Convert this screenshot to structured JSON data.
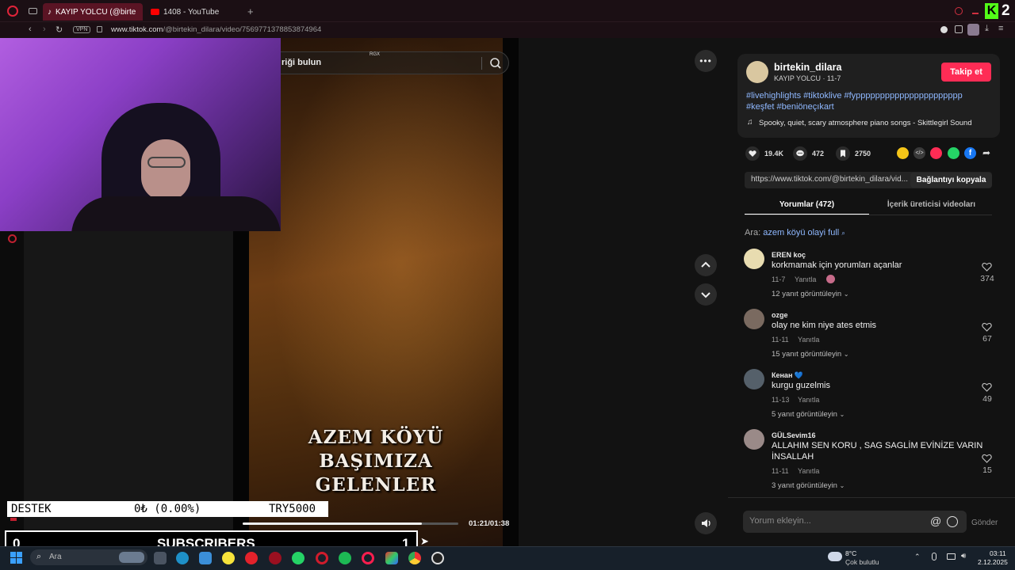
{
  "browser": {
    "tabs": [
      {
        "label": "KAYIP YOLCU (@birte"
      },
      {
        "label": "1408 - YouTube"
      }
    ],
    "vpn_label": "VPN",
    "url_host": "www.tiktok.com",
    "url_path": "/@birtekin_dilara/video/7569771378853874964",
    "k_badge": "2"
  },
  "search": {
    "placeholder": "riği bulun",
    "tag": "RGX"
  },
  "video": {
    "overlay_title_line1": "AZEM KÖYÜ BAŞIMIZA",
    "overlay_title_line2": "GELENLER",
    "time": "01:21/01:38",
    "progress": 0.83
  },
  "author": {
    "username": "birtekin_dilara",
    "display": "KAYIP YOLCU · 11-7",
    "follow_label": "Takip et",
    "hashtags_line1": "#livehighlights #tiktoklive #fypppppppppppppppppppppp",
    "hashtags_line2": "#keşfet #beniöneçıkart",
    "music": "Spooky, quiet, scary atmosphere piano songs - Skittlegirl Sound"
  },
  "stats": {
    "likes": "19.4K",
    "comments": "472",
    "saves": "2750"
  },
  "link": {
    "url": "https://www.tiktok.com/@birtekin_dilara/vid...",
    "copy_label": "Bağlantıyı kopyala"
  },
  "tabs": {
    "comments": "Yorumlar (472)",
    "creator_videos": "İçerik üreticisi videoları"
  },
  "search_suggestion": {
    "prefix": "Ara:",
    "query": "azem köyü olayi full"
  },
  "comments": [
    {
      "name": "EREN koç",
      "text": "korkmamak için yorumları açanlar",
      "date": "11-7",
      "reply": "Yanıtla",
      "likes": "374",
      "replies": "12 yanıt görüntüleyin",
      "avatar_color": "#e8dcb0"
    },
    {
      "name": "ozge",
      "text": "olay ne kim niye ates etmis",
      "date": "11-11",
      "reply": "Yanıtla",
      "likes": "67",
      "replies": "15 yanıt görüntüleyin",
      "avatar_color": "#7a6a60"
    },
    {
      "name": "Кенан 💙",
      "text": "kurgu guzelmis",
      "date": "11-13",
      "reply": "Yanıtla",
      "likes": "49",
      "replies": "5 yanıt görüntüleyin",
      "avatar_color": "#55606a"
    },
    {
      "name": "GÜLSevim16",
      "text": "ALLAHIM SEN KORU , SAG SAGLİM EVİNİZE VARIN",
      "text2": "İNSALLAH",
      "date": "11-11",
      "reply": "Yanıtla",
      "likes": "15",
      "replies": "3 yanıt görüntüleyin",
      "avatar_color": "#9a8a88"
    }
  ],
  "comment_input": {
    "placeholder": "Yorum ekleyin...",
    "send_label": "Gönder"
  },
  "stream_overlay": {
    "destek_label": "DESTEK",
    "destek_amount": "0₺ (0.00%)",
    "destek_goal": "TRY5000",
    "subs_left": "0",
    "subs_label": "SUBSCRIBERS",
    "subs_right": "1"
  },
  "taskbar": {
    "search_placeholder": "Ara",
    "weather_temp": "8°C",
    "weather_desc": "Çok bulutlu",
    "time": "03:11",
    "date": "2.12.2025"
  }
}
